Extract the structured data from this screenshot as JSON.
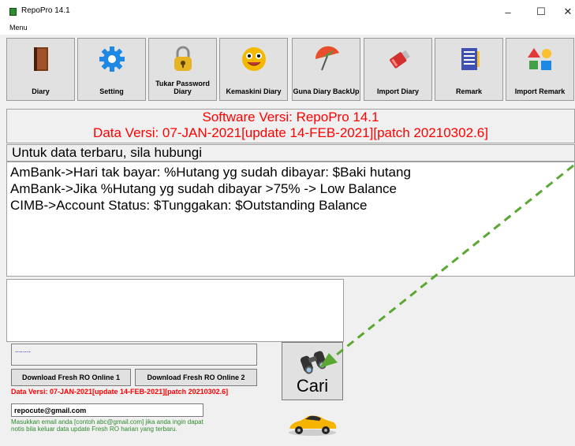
{
  "window": {
    "title": "RepoPro 14.1",
    "minimize": "–",
    "maximize": "☐",
    "close": "✕"
  },
  "menu": {
    "label": "Menu"
  },
  "toolbar": {
    "buttons": [
      {
        "label": "Diary",
        "icon": "book-icon"
      },
      {
        "label": "Setting",
        "icon": "gear-icon"
      },
      {
        "label": "Tukar Password Diary",
        "icon": "lock-icon"
      },
      {
        "label": "Kemaskini Diary",
        "icon": "smiley-icon"
      },
      {
        "label": "Guna Diary BackUp",
        "icon": "umbrella-icon"
      },
      {
        "label": "Import Diary",
        "icon": "usb-drive-icon"
      },
      {
        "label": "Remark",
        "icon": "notepad-icon"
      },
      {
        "label": "Import Remark",
        "icon": "shapes-icon"
      }
    ]
  },
  "version_panel": {
    "software": "Software Versi: RepoPro 14.1",
    "data": "Data Versi: 07-JAN-2021[update 14-FEB-2021][patch 20210302.6]"
  },
  "contact_panel": {
    "text": "Untuk data terbaru, sila hubungi"
  },
  "notes": [
    "AmBank->Hari tak bayar: %Hutang yg sudah dibayar: $Baki hutang",
    "AmBank->Jika %Hutang yg sudah dibayar >75% -> Low Balance",
    "CIMB->Account Status: $Tunggakan: $Outstanding Balance"
  ],
  "status": {
    "text": "........"
  },
  "download": {
    "btn1": "Download Fresh RO Online 1",
    "btn2": "Download Fresh RO Online 2"
  },
  "data_versi_small": "Data Versi: 07-JAN-2021[update 14-FEB-2021][patch 20210302.6]",
  "email": {
    "value": "repocute@gmail.com"
  },
  "help": {
    "line1": "Masukkan email anda [contoh abc@gmail.com] jika anda ingin dapat",
    "line2": "notis bila keluar data update Fresh RO harian yang terbaru."
  },
  "search": {
    "label": "Cari",
    "icon": "binoculars-icon"
  },
  "colors": {
    "accent_red": "#ff0000",
    "help_green": "#2e8b2e",
    "arrow_green": "#5aa832"
  }
}
